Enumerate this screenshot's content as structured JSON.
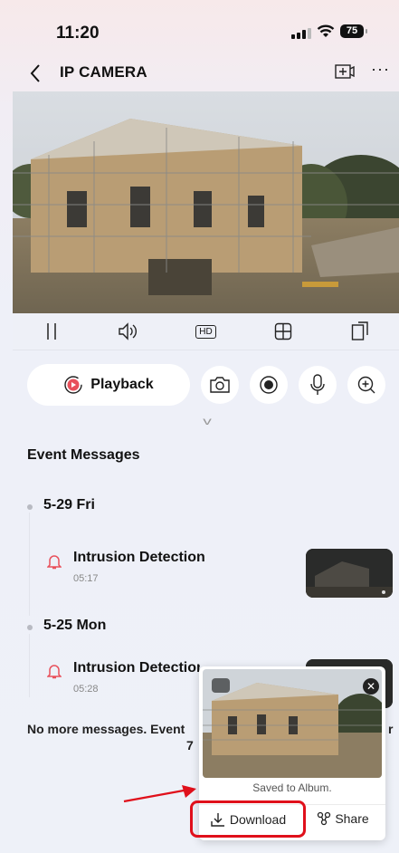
{
  "status_bar": {
    "time": "11:20",
    "battery": "75"
  },
  "nav": {
    "title": "IP CAMERA"
  },
  "controls": {
    "hd_label": "HD"
  },
  "actions": {
    "playback_label": "Playback"
  },
  "events": {
    "heading": "Event Messages",
    "groups": [
      {
        "date": "5-29 Fri",
        "items": [
          {
            "title": "Intrusion Detection",
            "time": "05:17"
          }
        ]
      },
      {
        "date": "5-25 Mon",
        "items": [
          {
            "title": "Intrusion Detection",
            "time": "05:28"
          }
        ]
      }
    ],
    "footer_line1": "No more messages. Event",
    "footer_line1_end": "r",
    "footer_line2": "7"
  },
  "popup": {
    "saved_text": "Saved to Album.",
    "download_label": "Download",
    "share_label": "Share"
  },
  "colors": {
    "accent_red": "#e0101b",
    "bell_red": "#e8505b"
  }
}
